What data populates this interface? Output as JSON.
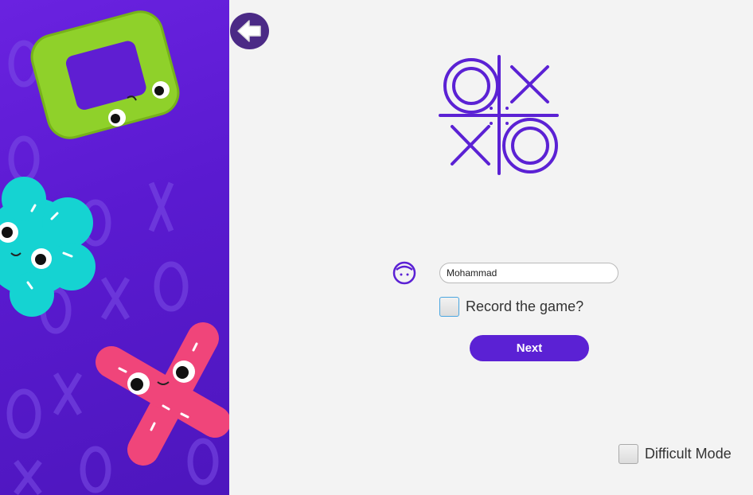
{
  "colors": {
    "accent": "#5b21d4",
    "panel": "#5a1ad0",
    "back_button": "#4b2a86",
    "background": "#f3f3f3"
  },
  "icons": {
    "back": "arrow-left-icon",
    "user": "face-icon",
    "logo": "tic-tac-toe-logo"
  },
  "player": {
    "name_value": "Mohammad"
  },
  "record": {
    "label": "Record the game?",
    "checked": false
  },
  "next": {
    "label": "Next"
  },
  "difficult": {
    "label": "Difficult Mode",
    "checked": false
  }
}
